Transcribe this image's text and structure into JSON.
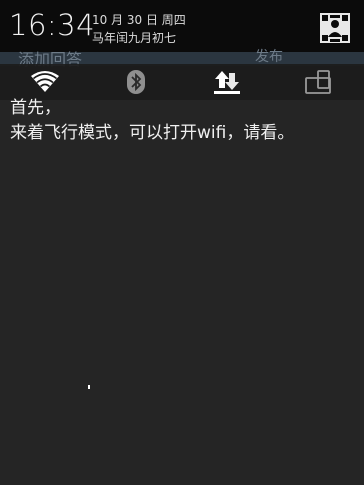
{
  "status_bar": {
    "time": "16:34",
    "date": "10 月 30 日 周四",
    "lunar_date": "马年闰九月初七",
    "settings_icon": "quick-settings-grid-icon"
  },
  "background_app": {
    "title_partial": "添加回答",
    "action_partial": "发布"
  },
  "quick_settings": {
    "toggles": [
      {
        "name": "wifi",
        "icon": "wifi-icon",
        "state": "on"
      },
      {
        "name": "bluetooth",
        "icon": "bluetooth-icon",
        "state": "off"
      },
      {
        "name": "mobile-data",
        "icon": "data-transfer-icon",
        "state": "on"
      },
      {
        "name": "auto-rotate",
        "icon": "rotate-icon",
        "state": "off"
      }
    ]
  },
  "content": {
    "line1": "首先，",
    "line2": "来着飞行模式，可以打开wifi，请看。"
  },
  "colors": {
    "background": "#252525",
    "status_bar": "#0b0b0b",
    "icon_active": "#ffffff",
    "icon_inactive": "#9a9a9a"
  }
}
